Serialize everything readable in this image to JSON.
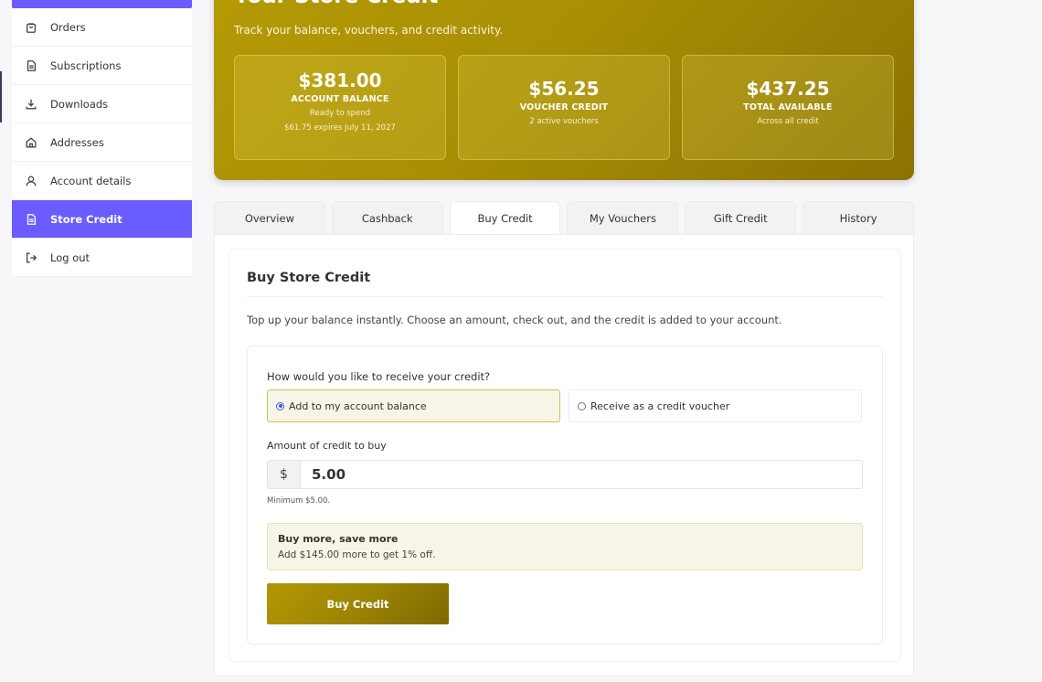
{
  "sidebar": {
    "items": [
      {
        "label": "Orders",
        "icon": "bag-icon"
      },
      {
        "label": "Subscriptions",
        "icon": "document-icon"
      },
      {
        "label": "Downloads",
        "icon": "download-icon"
      },
      {
        "label": "Addresses",
        "icon": "home-icon"
      },
      {
        "label": "Account details",
        "icon": "user-icon"
      },
      {
        "label": "Store Credit",
        "icon": "document-icon",
        "active": true
      },
      {
        "label": "Log out",
        "icon": "logout-icon"
      }
    ],
    "accent_color": "#6a5cff"
  },
  "hero": {
    "title": "Your Store Credit",
    "subtitle": "Track your balance, vouchers, and credit activity.",
    "stats": [
      {
        "amount": "$381.00",
        "label": "ACCOUNT BALANCE",
        "note1": "Ready to spend",
        "note2": "$61.75 expires July 11, 2027"
      },
      {
        "amount": "$56.25",
        "label": "VOUCHER CREDIT",
        "note1": "2 active vouchers"
      },
      {
        "amount": "$437.25",
        "label": "TOTAL AVAILABLE",
        "note1": "Across all credit"
      }
    ],
    "color": "#a88f04"
  },
  "tabs": [
    {
      "label": "Overview"
    },
    {
      "label": "Cashback"
    },
    {
      "label": "Buy Credit",
      "active": true
    },
    {
      "label": "My Vouchers"
    },
    {
      "label": "Gift Credit"
    },
    {
      "label": "History"
    }
  ],
  "buy": {
    "title": "Buy Store Credit",
    "description": "Top up your balance instantly. Choose an amount, check out, and the credit is added to your account.",
    "question": "How would you like to receive your credit?",
    "option_balance": "Add to my account balance",
    "option_voucher": "Receive as a credit voucher",
    "selected_option": "balance",
    "amount_label": "Amount of credit to buy",
    "currency_symbol": "$",
    "amount_value": "5.00",
    "minimum_note": "Minimum $5.00.",
    "promo_title": "Buy more, save more",
    "promo_text": "Add $145.00 more to get 1% off.",
    "button_label": "Buy Credit"
  }
}
